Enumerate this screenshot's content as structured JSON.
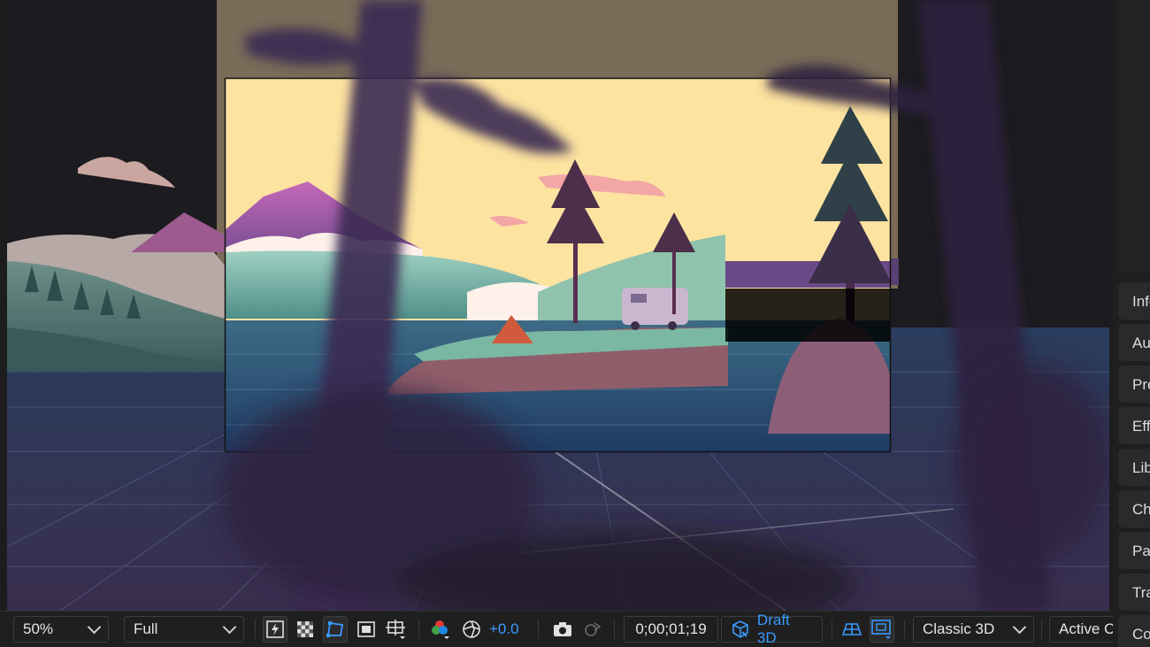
{
  "toolbar": {
    "magnification": "50%",
    "resolution": "Full",
    "exposure": "+0.0",
    "timecode": "0;00;01;19",
    "draft3d_label": "Draft 3D",
    "renderer": "Classic 3D",
    "view": "Active C"
  },
  "panels": [
    {
      "label": "Info"
    },
    {
      "label": "Audio"
    },
    {
      "label": "Preview"
    },
    {
      "label": "Effects"
    },
    {
      "label": "Libraries"
    },
    {
      "label": "Character"
    },
    {
      "label": "Paragraph"
    },
    {
      "label": "Tracker"
    },
    {
      "label": "Content"
    }
  ],
  "icons": {
    "fast_preview": "lightning-icon",
    "transparency": "checkerboard-icon",
    "mask_toggle": "mask-path-icon",
    "region_of_interest": "region-of-interest-icon",
    "grid_guides": "grid-guides-icon",
    "channels": "rgb-channels-icon",
    "color_management": "color-management-icon",
    "snapshot": "camera-icon",
    "show_snapshot": "show-snapshot-icon",
    "draft3d": "cube-icon",
    "ground_plane": "ground-plane-icon",
    "extended_viewer": "extended-viewer-icon"
  },
  "colors": {
    "accent": "#3a9bff",
    "sky": "#fde3a0",
    "water": "#2a4f6e",
    "foliage_shadow": "#2e2440"
  }
}
